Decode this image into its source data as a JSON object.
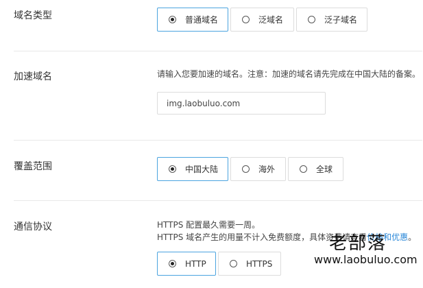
{
  "domain_type": {
    "label": "域名类型",
    "options": [
      "普通域名",
      "泛域名",
      "泛子域名"
    ],
    "selected": "普通域名"
  },
  "accel_domain": {
    "label": "加速域名",
    "hint": "请输入您要加速的域名。注意：加速的域名请先完成在中国大陆的备案。",
    "value": "img.laobuluo.com"
  },
  "coverage": {
    "label": "覆盖范围",
    "options": [
      "中国大陆",
      "海外",
      "全球"
    ],
    "selected": "中国大陆"
  },
  "protocol": {
    "label": "通信协议",
    "hint_line1": "HTTPS 配置最久需要一周。",
    "hint_line2_prefix": "HTTPS 域名产生的用量不计入免费额度，具体资费请查看",
    "hint_link": "价格和优惠",
    "hint_line2_suffix": "。",
    "options": [
      "HTTP",
      "HTTPS"
    ],
    "selected": "HTTP"
  },
  "watermark": {
    "cn": "老部落",
    "en": "www.laobuluo.com"
  },
  "colors": {
    "accent": "#4aa3df",
    "link": "#2c89d9",
    "divider": "#e8e8e8"
  }
}
